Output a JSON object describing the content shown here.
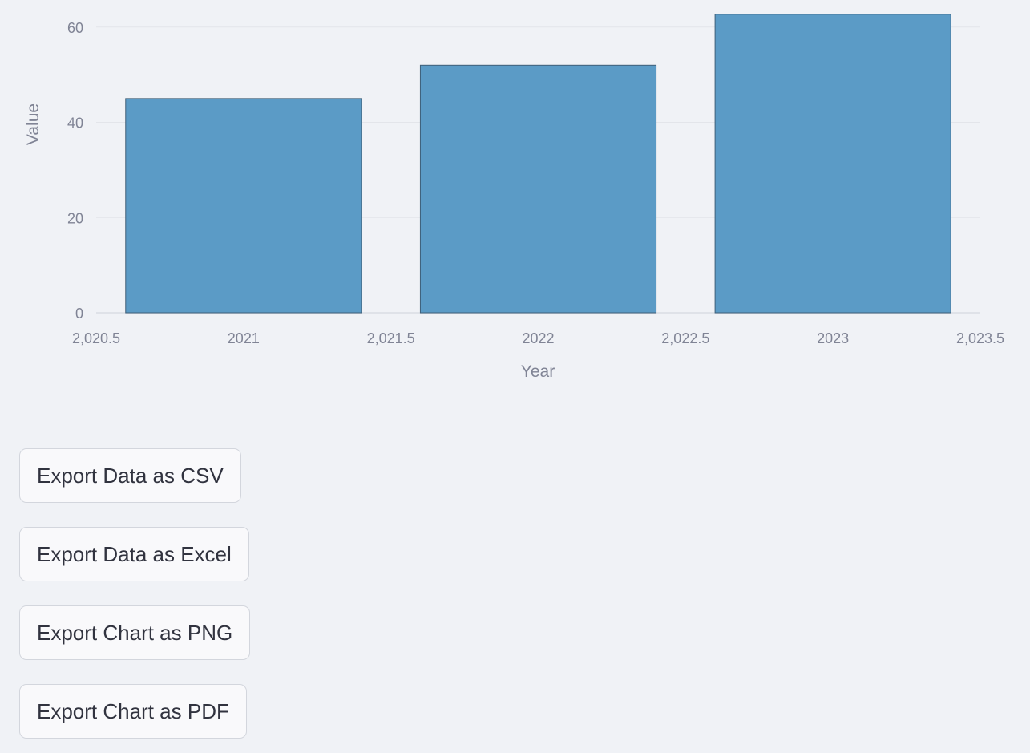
{
  "chart_data": {
    "type": "bar",
    "x": [
      2021,
      2022,
      2023
    ],
    "values": [
      45,
      52,
      62.7
    ],
    "bar_width": 0.8,
    "xlim": [
      2020.5,
      2023.5
    ],
    "ylim": [
      0,
      63
    ],
    "x_ticks": [
      2020.5,
      2021,
      2021.5,
      2022,
      2022.5,
      2023,
      2023.5
    ],
    "x_tick_labels": [
      "2,020.5",
      "2021",
      "2,021.5",
      "2022",
      "2,022.5",
      "2023",
      "2,023.5"
    ],
    "y_ticks": [
      0,
      20,
      40,
      60
    ],
    "y_tick_labels": [
      "0",
      "20",
      "40",
      "60"
    ],
    "xlabel": "Year",
    "ylabel": "Value",
    "bar_color": "#5b9bc6",
    "grid": true
  },
  "buttons": {
    "export_csv": "Export Data as CSV",
    "export_excel": "Export Data as Excel",
    "export_png": "Export Chart as PNG",
    "export_pdf": "Export Chart as PDF"
  }
}
